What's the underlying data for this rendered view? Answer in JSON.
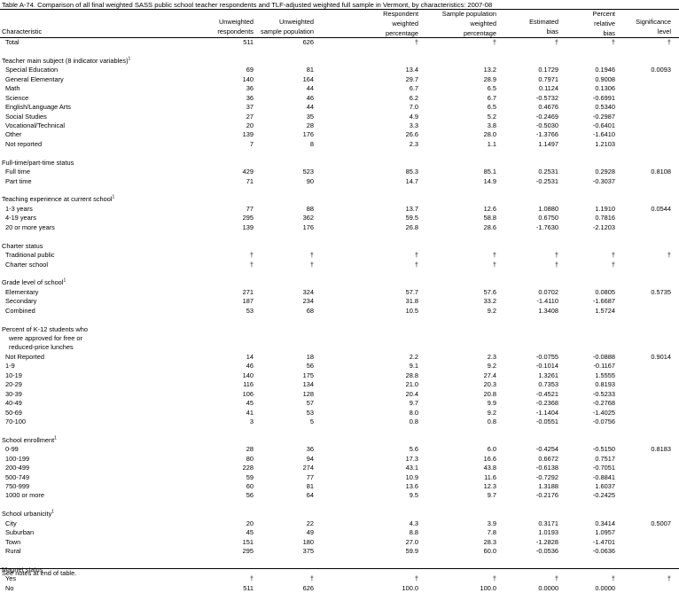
{
  "title": "Table A-74. Comparison of all final weighted SASS public school teacher respondents and TLF-adjusted weighted full sample in Vermont, by characteristics: 2007-08",
  "headers": {
    "characteristic": "Characteristic",
    "unweighted_respondents": [
      "Unweighted",
      "respondents"
    ],
    "unweighted_sample": [
      "Unweighted",
      "sample population"
    ],
    "respondent_weighted": [
      "Respondent",
      "weighted",
      "percentage"
    ],
    "sample_weighted": [
      "Sample population",
      "weighted",
      "percentage"
    ],
    "estimated_bias": [
      "Estimated",
      "bias"
    ],
    "percent_relative_bias": [
      "Percent",
      "relative",
      "bias"
    ],
    "significance": [
      "Significance",
      "level"
    ]
  },
  "rows": [
    {
      "label": "Total",
      "indent": 1,
      "v": [
        "511",
        "626",
        "†",
        "†",
        "†",
        "†",
        "†"
      ]
    },
    {
      "blank": true
    },
    {
      "label": "Teacher main subject (8 indicator variables)",
      "sup": "1",
      "indent": 0,
      "v": [
        "",
        "",
        "",
        "",
        "",
        "",
        ""
      ]
    },
    {
      "label": "Special Education",
      "indent": 1,
      "v": [
        "69",
        "81",
        "13.4",
        "13.2",
        "0.1729",
        "0.1946",
        "0.0093"
      ]
    },
    {
      "label": "General Elementary",
      "indent": 1,
      "v": [
        "140",
        "164",
        "29.7",
        "28.9",
        "0.7971",
        "0.9008",
        ""
      ]
    },
    {
      "label": "Math",
      "indent": 1,
      "v": [
        "36",
        "44",
        "6.7",
        "6.5",
        "0.1124",
        "0.1306",
        ""
      ]
    },
    {
      "label": "Science",
      "indent": 1,
      "v": [
        "36",
        "46",
        "6.2",
        "6.7",
        "-0.5732",
        "-0.6991",
        ""
      ]
    },
    {
      "label": "English/Language Arts",
      "indent": 1,
      "v": [
        "37",
        "44",
        "7.0",
        "6.5",
        "0.4676",
        "0.5340",
        ""
      ]
    },
    {
      "label": "Social Studies",
      "indent": 1,
      "v": [
        "27",
        "35",
        "4.9",
        "5.2",
        "-0.2469",
        "-0.2987",
        ""
      ]
    },
    {
      "label": "Vocational/Technical",
      "indent": 1,
      "v": [
        "20",
        "28",
        "3.3",
        "3.8",
        "-0.5030",
        "-0.6401",
        ""
      ]
    },
    {
      "label": "Other",
      "indent": 1,
      "v": [
        "139",
        "176",
        "26.6",
        "28.0",
        "-1.3766",
        "-1.6410",
        ""
      ]
    },
    {
      "label": "Not reported",
      "indent": 1,
      "v": [
        "7",
        "8",
        "2.3",
        "1.1",
        "1.1497",
        "1.2103",
        ""
      ]
    },
    {
      "blank": true
    },
    {
      "label": "Full-time/part-time status",
      "indent": 0,
      "v": [
        "",
        "",
        "",
        "",
        "",
        "",
        ""
      ]
    },
    {
      "label": "Full time",
      "indent": 1,
      "v": [
        "429",
        "523",
        "85.3",
        "85.1",
        "0.2531",
        "0.2928",
        "0.8108"
      ]
    },
    {
      "label": "Part time",
      "indent": 1,
      "v": [
        "71",
        "90",
        "14.7",
        "14.9",
        "-0.2531",
        "-0.3037",
        ""
      ]
    },
    {
      "blank": true
    },
    {
      "label": "Teaching experience at current school",
      "sup": "1",
      "indent": 0,
      "v": [
        "",
        "",
        "",
        "",
        "",
        "",
        ""
      ]
    },
    {
      "label": "1-3 years",
      "indent": 1,
      "v": [
        "77",
        "88",
        "13.7",
        "12.6",
        "1.0880",
        "1.1910",
        "0.0544"
      ]
    },
    {
      "label": "4-19 years",
      "indent": 1,
      "v": [
        "295",
        "362",
        "59.5",
        "58.8",
        "0.6750",
        "0.7816",
        ""
      ]
    },
    {
      "label": "20 or more years",
      "indent": 1,
      "v": [
        "139",
        "176",
        "26.8",
        "28.6",
        "-1.7630",
        "-2.1203",
        ""
      ]
    },
    {
      "blank": true
    },
    {
      "label": "Charter status",
      "indent": 0,
      "v": [
        "",
        "",
        "",
        "",
        "",
        "",
        ""
      ]
    },
    {
      "label": "Traditional public",
      "indent": 1,
      "v": [
        "†",
        "†",
        "†",
        "†",
        "†",
        "†",
        "†"
      ]
    },
    {
      "label": "Charter school",
      "indent": 1,
      "v": [
        "†",
        "†",
        "†",
        "†",
        "†",
        "†",
        ""
      ]
    },
    {
      "blank": true
    },
    {
      "label": "Grade level of school",
      "sup": "1",
      "indent": 0,
      "v": [
        "",
        "",
        "",
        "",
        "",
        "",
        ""
      ]
    },
    {
      "label": "Elementary",
      "indent": 1,
      "v": [
        "271",
        "324",
        "57.7",
        "57.6",
        "0.0702",
        "0.0805",
        "0.5735"
      ]
    },
    {
      "label": "Secondary",
      "indent": 1,
      "v": [
        "187",
        "234",
        "31.8",
        "33.2",
        "-1.4110",
        "-1.6687",
        ""
      ]
    },
    {
      "label": "Combined",
      "indent": 1,
      "v": [
        "53",
        "68",
        "10.5",
        "9.2",
        "1.3408",
        "1.5724",
        ""
      ]
    },
    {
      "blank": true
    },
    {
      "label": "Percent of K-12 students who",
      "indent": 0,
      "v": [
        "",
        "",
        "",
        "",
        "",
        "",
        ""
      ]
    },
    {
      "label": "were approved for free or",
      "indent": 2,
      "v": [
        "",
        "",
        "",
        "",
        "",
        "",
        ""
      ]
    },
    {
      "label": "reduced-price lunches",
      "indent": 2,
      "v": [
        "",
        "",
        "",
        "",
        "",
        "",
        ""
      ]
    },
    {
      "label": "Not Reported",
      "indent": 1,
      "v": [
        "14",
        "18",
        "2.2",
        "2.3",
        "-0.0755",
        "-0.0888",
        "0.9014"
      ]
    },
    {
      "label": "1-9",
      "indent": 1,
      "v": [
        "46",
        "56",
        "9.1",
        "9.2",
        "-0.1014",
        "-0.1167",
        ""
      ]
    },
    {
      "label": "10-19",
      "indent": 1,
      "v": [
        "140",
        "175",
        "28.8",
        "27.4",
        "1.3261",
        "1.5555",
        ""
      ]
    },
    {
      "label": "20-29",
      "indent": 1,
      "v": [
        "116",
        "134",
        "21.0",
        "20.3",
        "0.7353",
        "0.8193",
        ""
      ]
    },
    {
      "label": "30-39",
      "indent": 1,
      "v": [
        "106",
        "128",
        "20.4",
        "20.8",
        "-0.4521",
        "-0.5233",
        ""
      ]
    },
    {
      "label": "40-49",
      "indent": 1,
      "v": [
        "45",
        "57",
        "9.7",
        "9.9",
        "-0.2368",
        "-0.2768",
        ""
      ]
    },
    {
      "label": "50-69",
      "indent": 1,
      "v": [
        "41",
        "53",
        "8.0",
        "9.2",
        "-1.1404",
        "-1.4025",
        ""
      ]
    },
    {
      "label": "70-100",
      "indent": 1,
      "v": [
        "3",
        "5",
        "0.8",
        "0.8",
        "-0.0551",
        "-0.0756",
        ""
      ]
    },
    {
      "blank": true
    },
    {
      "label": "School enrollment",
      "sup": "1",
      "indent": 0,
      "v": [
        "",
        "",
        "",
        "",
        "",
        "",
        ""
      ]
    },
    {
      "label": "0-99",
      "indent": 1,
      "v": [
        "28",
        "36",
        "5.6",
        "6.0",
        "-0.4254",
        "-0.5150",
        "0.8183"
      ]
    },
    {
      "label": "100-199",
      "indent": 1,
      "v": [
        "80",
        "94",
        "17.3",
        "16.6",
        "0.6672",
        "0.7517",
        ""
      ]
    },
    {
      "label": "200-499",
      "indent": 1,
      "v": [
        "228",
        "274",
        "43.1",
        "43.8",
        "-0.6138",
        "-0.7051",
        ""
      ]
    },
    {
      "label": "500-749",
      "indent": 1,
      "v": [
        "59",
        "77",
        "10.9",
        "11.6",
        "-0.7292",
        "-0.8841",
        ""
      ]
    },
    {
      "label": "750-999",
      "indent": 1,
      "v": [
        "60",
        "81",
        "13.6",
        "12.3",
        "1.3188",
        "1.6037",
        ""
      ]
    },
    {
      "label": "1000 or more",
      "indent": 1,
      "v": [
        "56",
        "64",
        "9.5",
        "9.7",
        "-0.2176",
        "-0.2425",
        ""
      ]
    },
    {
      "blank": true
    },
    {
      "label": "School urbanicity",
      "sup": "1",
      "indent": 0,
      "v": [
        "",
        "",
        "",
        "",
        "",
        "",
        ""
      ]
    },
    {
      "label": "City",
      "indent": 1,
      "v": [
        "20",
        "22",
        "4.3",
        "3.9",
        "0.3171",
        "0.3414",
        "0.5007"
      ]
    },
    {
      "label": "Suburban",
      "indent": 1,
      "v": [
        "45",
        "49",
        "8.8",
        "7.8",
        "1.0193",
        "1.0957",
        ""
      ]
    },
    {
      "label": "Town",
      "indent": 1,
      "v": [
        "151",
        "180",
        "27.0",
        "28.3",
        "-1.2828",
        "-1.4701",
        ""
      ]
    },
    {
      "label": "Rural",
      "indent": 1,
      "v": [
        "295",
        "375",
        "59.9",
        "60.0",
        "-0.0536",
        "-0.0636",
        ""
      ]
    },
    {
      "blank": true
    },
    {
      "label": "Magnet status",
      "indent": 0,
      "v": [
        "",
        "",
        "",
        "",
        "",
        "",
        ""
      ]
    },
    {
      "label": "Yes",
      "indent": 1,
      "v": [
        "†",
        "†",
        "†",
        "†",
        "†",
        "†",
        "†"
      ]
    },
    {
      "label": "No",
      "indent": 1,
      "v": [
        "511",
        "626",
        "100.0",
        "100.0",
        "0.0000",
        "0.0000",
        ""
      ]
    }
  ],
  "footnote": "See notes at end of table."
}
